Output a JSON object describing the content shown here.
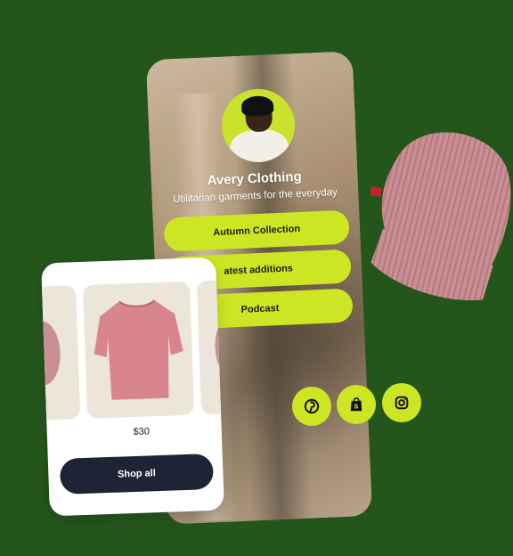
{
  "profile": {
    "name": "Avery Clothing",
    "tagline": "Utilitarian garments for the everyday"
  },
  "links": [
    {
      "label": "Autumn Collection"
    },
    {
      "label": "atest additions"
    },
    {
      "label": "Podcast"
    }
  ],
  "shop": {
    "price": "$30",
    "button_label": "Shop all"
  },
  "social": [
    "pinterest-icon",
    "shopify-icon",
    "instagram-icon"
  ],
  "colors": {
    "background": "#24561c",
    "accent": "#cde624",
    "button_dark": "#1e2436"
  }
}
